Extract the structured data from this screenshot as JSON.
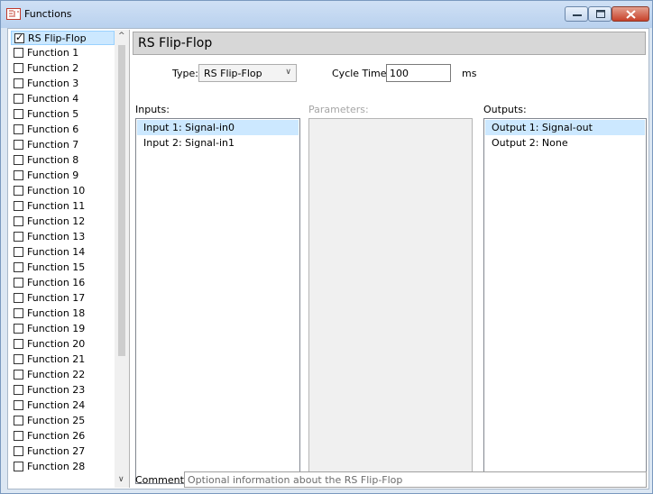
{
  "window": {
    "title": "Functions",
    "minimize_icon": "minimize-icon",
    "maximize_icon": "maximize-icon",
    "close_icon": "close-icon"
  },
  "sidebar": {
    "items": [
      {
        "label": "RS Flip-Flop",
        "checked": true,
        "selected": true
      },
      {
        "label": "Function 1",
        "checked": false
      },
      {
        "label": "Function 2",
        "checked": false
      },
      {
        "label": "Function 3",
        "checked": false
      },
      {
        "label": "Function 4",
        "checked": false
      },
      {
        "label": "Function 5",
        "checked": false
      },
      {
        "label": "Function 6",
        "checked": false
      },
      {
        "label": "Function 7",
        "checked": false
      },
      {
        "label": "Function 8",
        "checked": false
      },
      {
        "label": "Function 9",
        "checked": false
      },
      {
        "label": "Function 10",
        "checked": false
      },
      {
        "label": "Function 11",
        "checked": false
      },
      {
        "label": "Function 12",
        "checked": false
      },
      {
        "label": "Function 13",
        "checked": false
      },
      {
        "label": "Function 14",
        "checked": false
      },
      {
        "label": "Function 15",
        "checked": false
      },
      {
        "label": "Function 16",
        "checked": false
      },
      {
        "label": "Function 17",
        "checked": false
      },
      {
        "label": "Function 18",
        "checked": false
      },
      {
        "label": "Function 19",
        "checked": false
      },
      {
        "label": "Function 20",
        "checked": false
      },
      {
        "label": "Function 21",
        "checked": false
      },
      {
        "label": "Function 22",
        "checked": false
      },
      {
        "label": "Function 23",
        "checked": false
      },
      {
        "label": "Function 24",
        "checked": false
      },
      {
        "label": "Function 25",
        "checked": false
      },
      {
        "label": "Function 26",
        "checked": false
      },
      {
        "label": "Function 27",
        "checked": false
      },
      {
        "label": "Function 28",
        "checked": false
      }
    ],
    "scroll_up_icon": "^",
    "scroll_down_icon": "v"
  },
  "main": {
    "header": "RS Flip-Flop",
    "type_label": "Type:",
    "type_value": "RS Flip-Flop",
    "cycle_time_label": "Cycle Time:",
    "cycle_time_value": "100",
    "cycle_time_unit": "ms",
    "inputs_label": "Inputs:",
    "parameters_label": "Parameters:",
    "outputs_label": "Outputs:",
    "inputs": [
      "Input 1: Signal-in0",
      "Input 2: Signal-in1"
    ],
    "outputs": [
      "Output 1: Signal-out",
      "Output 2: None"
    ],
    "comment_label": "Comment:",
    "comment_placeholder": "Optional information about the RS Flip-Flop"
  },
  "colors": {
    "selection": "#cce8ff",
    "titlebar": "#c4d9f2",
    "header_bg": "#d7d7d7"
  }
}
